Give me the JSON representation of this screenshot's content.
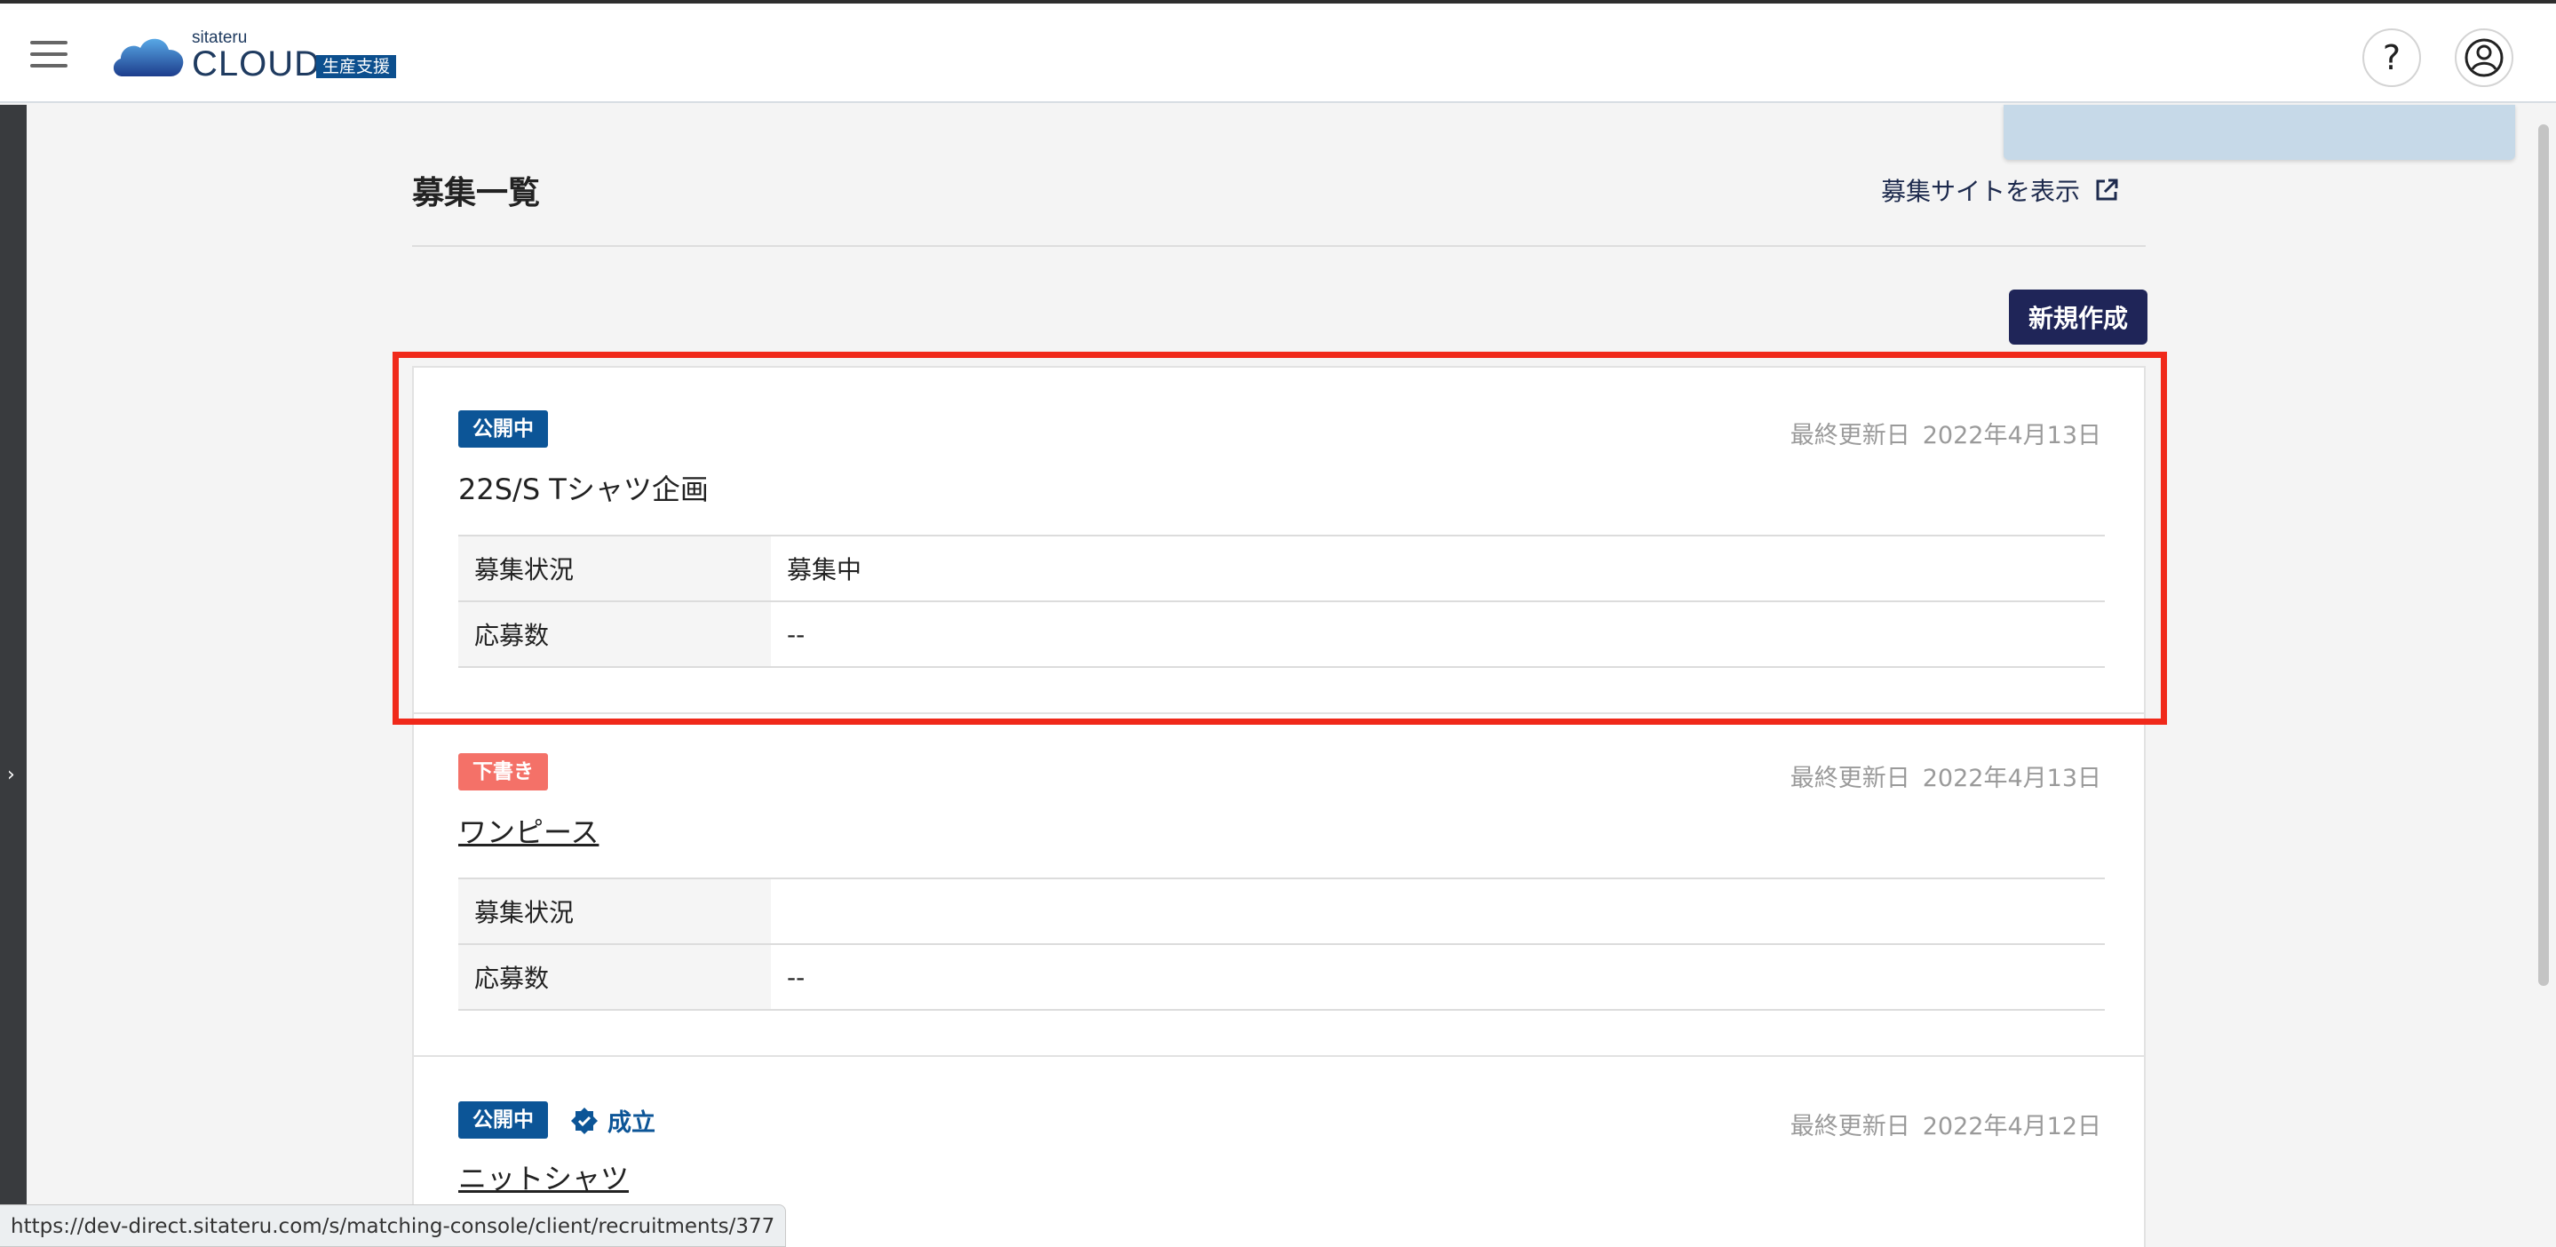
{
  "header": {
    "logo_sub": "sitateru",
    "logo_main": "CLOUD",
    "logo_badge": "生産支援",
    "help_label": "?"
  },
  "page": {
    "title": "募集一覧",
    "site_link": "募集サイトを表示",
    "new_button": "新規作成"
  },
  "labels": {
    "updated": "最終更新日",
    "status": "募集状況",
    "applicants": "応募数"
  },
  "recruitments": [
    {
      "badge": "公開中",
      "updated_date": "2022年4月13日",
      "title": "22S/S Tシャツ企画",
      "status_value": "募集中",
      "applicants_value": "--"
    },
    {
      "badge": "下書き",
      "updated_date": "2022年4月13日",
      "title": "ワンピース",
      "status_value": "",
      "applicants_value": "--"
    },
    {
      "badge": "公開中",
      "established": "成立",
      "updated_date": "2022年4月12日",
      "title": "ニットシャツ"
    }
  ],
  "status_bar": {
    "url": "https://dev-direct.sitateru.com/s/matching-console/client/recruitments/377"
  },
  "colors": {
    "accent": "#1f2558",
    "public_badge": "#0c5597",
    "draft_badge": "#f47168",
    "highlight": "#f0291a"
  }
}
